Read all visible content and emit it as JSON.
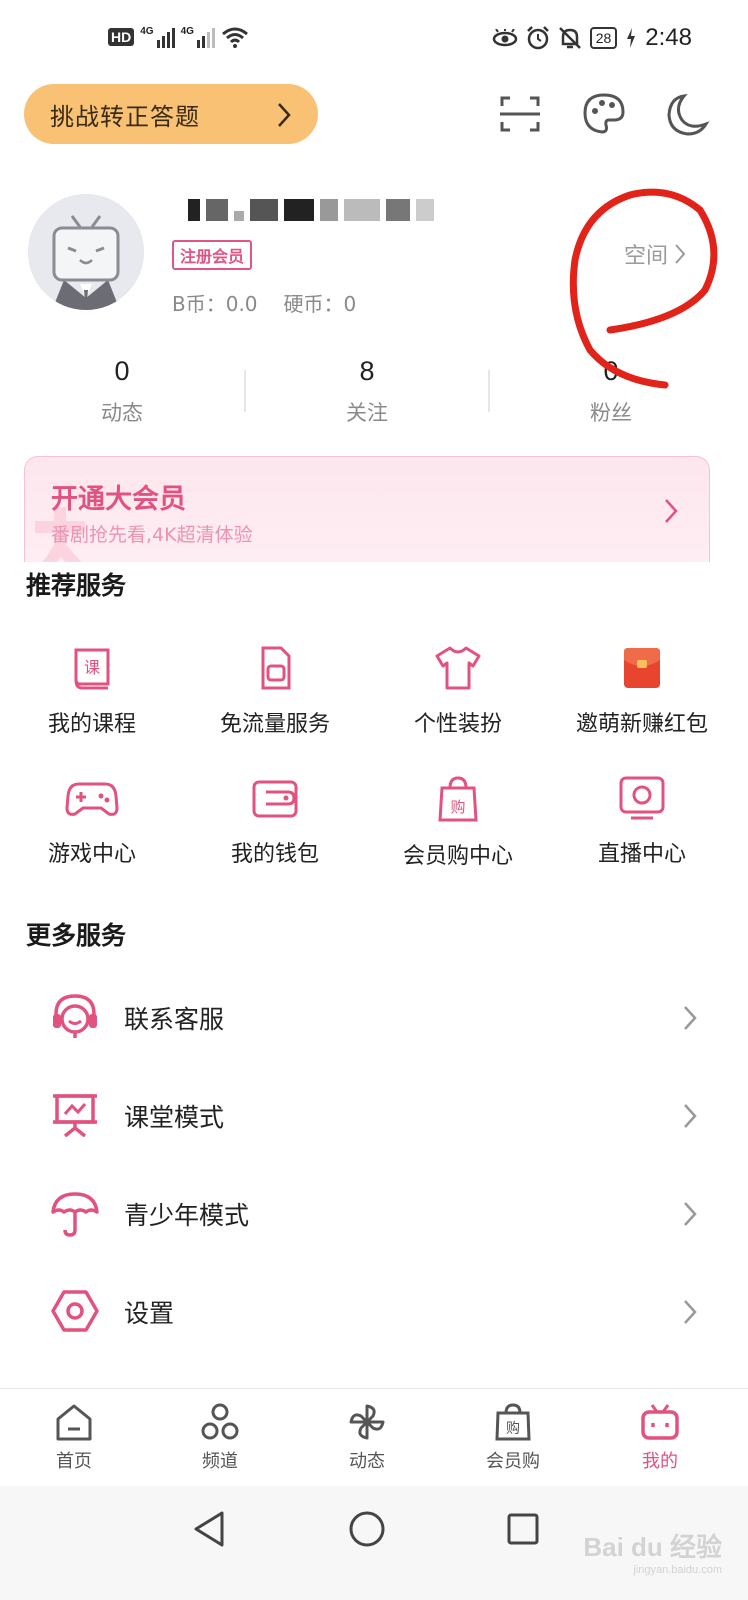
{
  "status_bar": {
    "hd_label": "HD",
    "network_1": "4G",
    "network_2": "4G",
    "battery": "28",
    "time": "2:48"
  },
  "top_bar": {
    "challenge_label": "挑战转正答题",
    "icons": [
      "scan-icon",
      "palette-icon",
      "night-mode-icon"
    ]
  },
  "profile": {
    "member_badge": "注册会员",
    "b_coin": "B币：0.0",
    "hard_coin": "硬币：0",
    "space_link": "空间"
  },
  "stats": [
    {
      "value": "0",
      "label": "动态"
    },
    {
      "value": "8",
      "label": "关注"
    },
    {
      "value": "0",
      "label": "粉丝"
    }
  ],
  "vip_banner": {
    "title": "开通大会员",
    "subtitle": "番剧抢先看,4K超清体验"
  },
  "recommended": {
    "title": "推荐服务",
    "items": [
      {
        "label": "我的课程",
        "icon": "course-icon"
      },
      {
        "label": "免流量服务",
        "icon": "sim-card-icon"
      },
      {
        "label": "个性装扮",
        "icon": "tshirt-icon"
      },
      {
        "label": "邀萌新赚红包",
        "icon": "red-packet-icon"
      },
      {
        "label": "游戏中心",
        "icon": "gamepad-icon"
      },
      {
        "label": "我的钱包",
        "icon": "wallet-icon"
      },
      {
        "label": "会员购中心",
        "icon": "shopping-bag-icon"
      },
      {
        "label": "直播中心",
        "icon": "live-tv-icon"
      }
    ]
  },
  "more": {
    "title": "更多服务",
    "items": [
      {
        "label": "联系客服",
        "icon": "headset-icon"
      },
      {
        "label": "课堂模式",
        "icon": "classroom-icon"
      },
      {
        "label": "青少年模式",
        "icon": "umbrella-icon"
      },
      {
        "label": "设置",
        "icon": "settings-icon"
      }
    ]
  },
  "bottom_nav": [
    {
      "label": "首页",
      "icon": "home-icon"
    },
    {
      "label": "频道",
      "icon": "channel-icon"
    },
    {
      "label": "动态",
      "icon": "pinwheel-icon"
    },
    {
      "label": "会员购",
      "icon": "shop-bag-icon"
    },
    {
      "label": "我的",
      "icon": "tv-mascot-icon",
      "active": true
    }
  ],
  "colors": {
    "accent_pink": "#e2527f",
    "challenge_orange": "#f8c173",
    "annotation_red": "#e2231a"
  },
  "watermark": {
    "brand": "Bai du 经验",
    "url": "jingyan.baidu.com"
  }
}
